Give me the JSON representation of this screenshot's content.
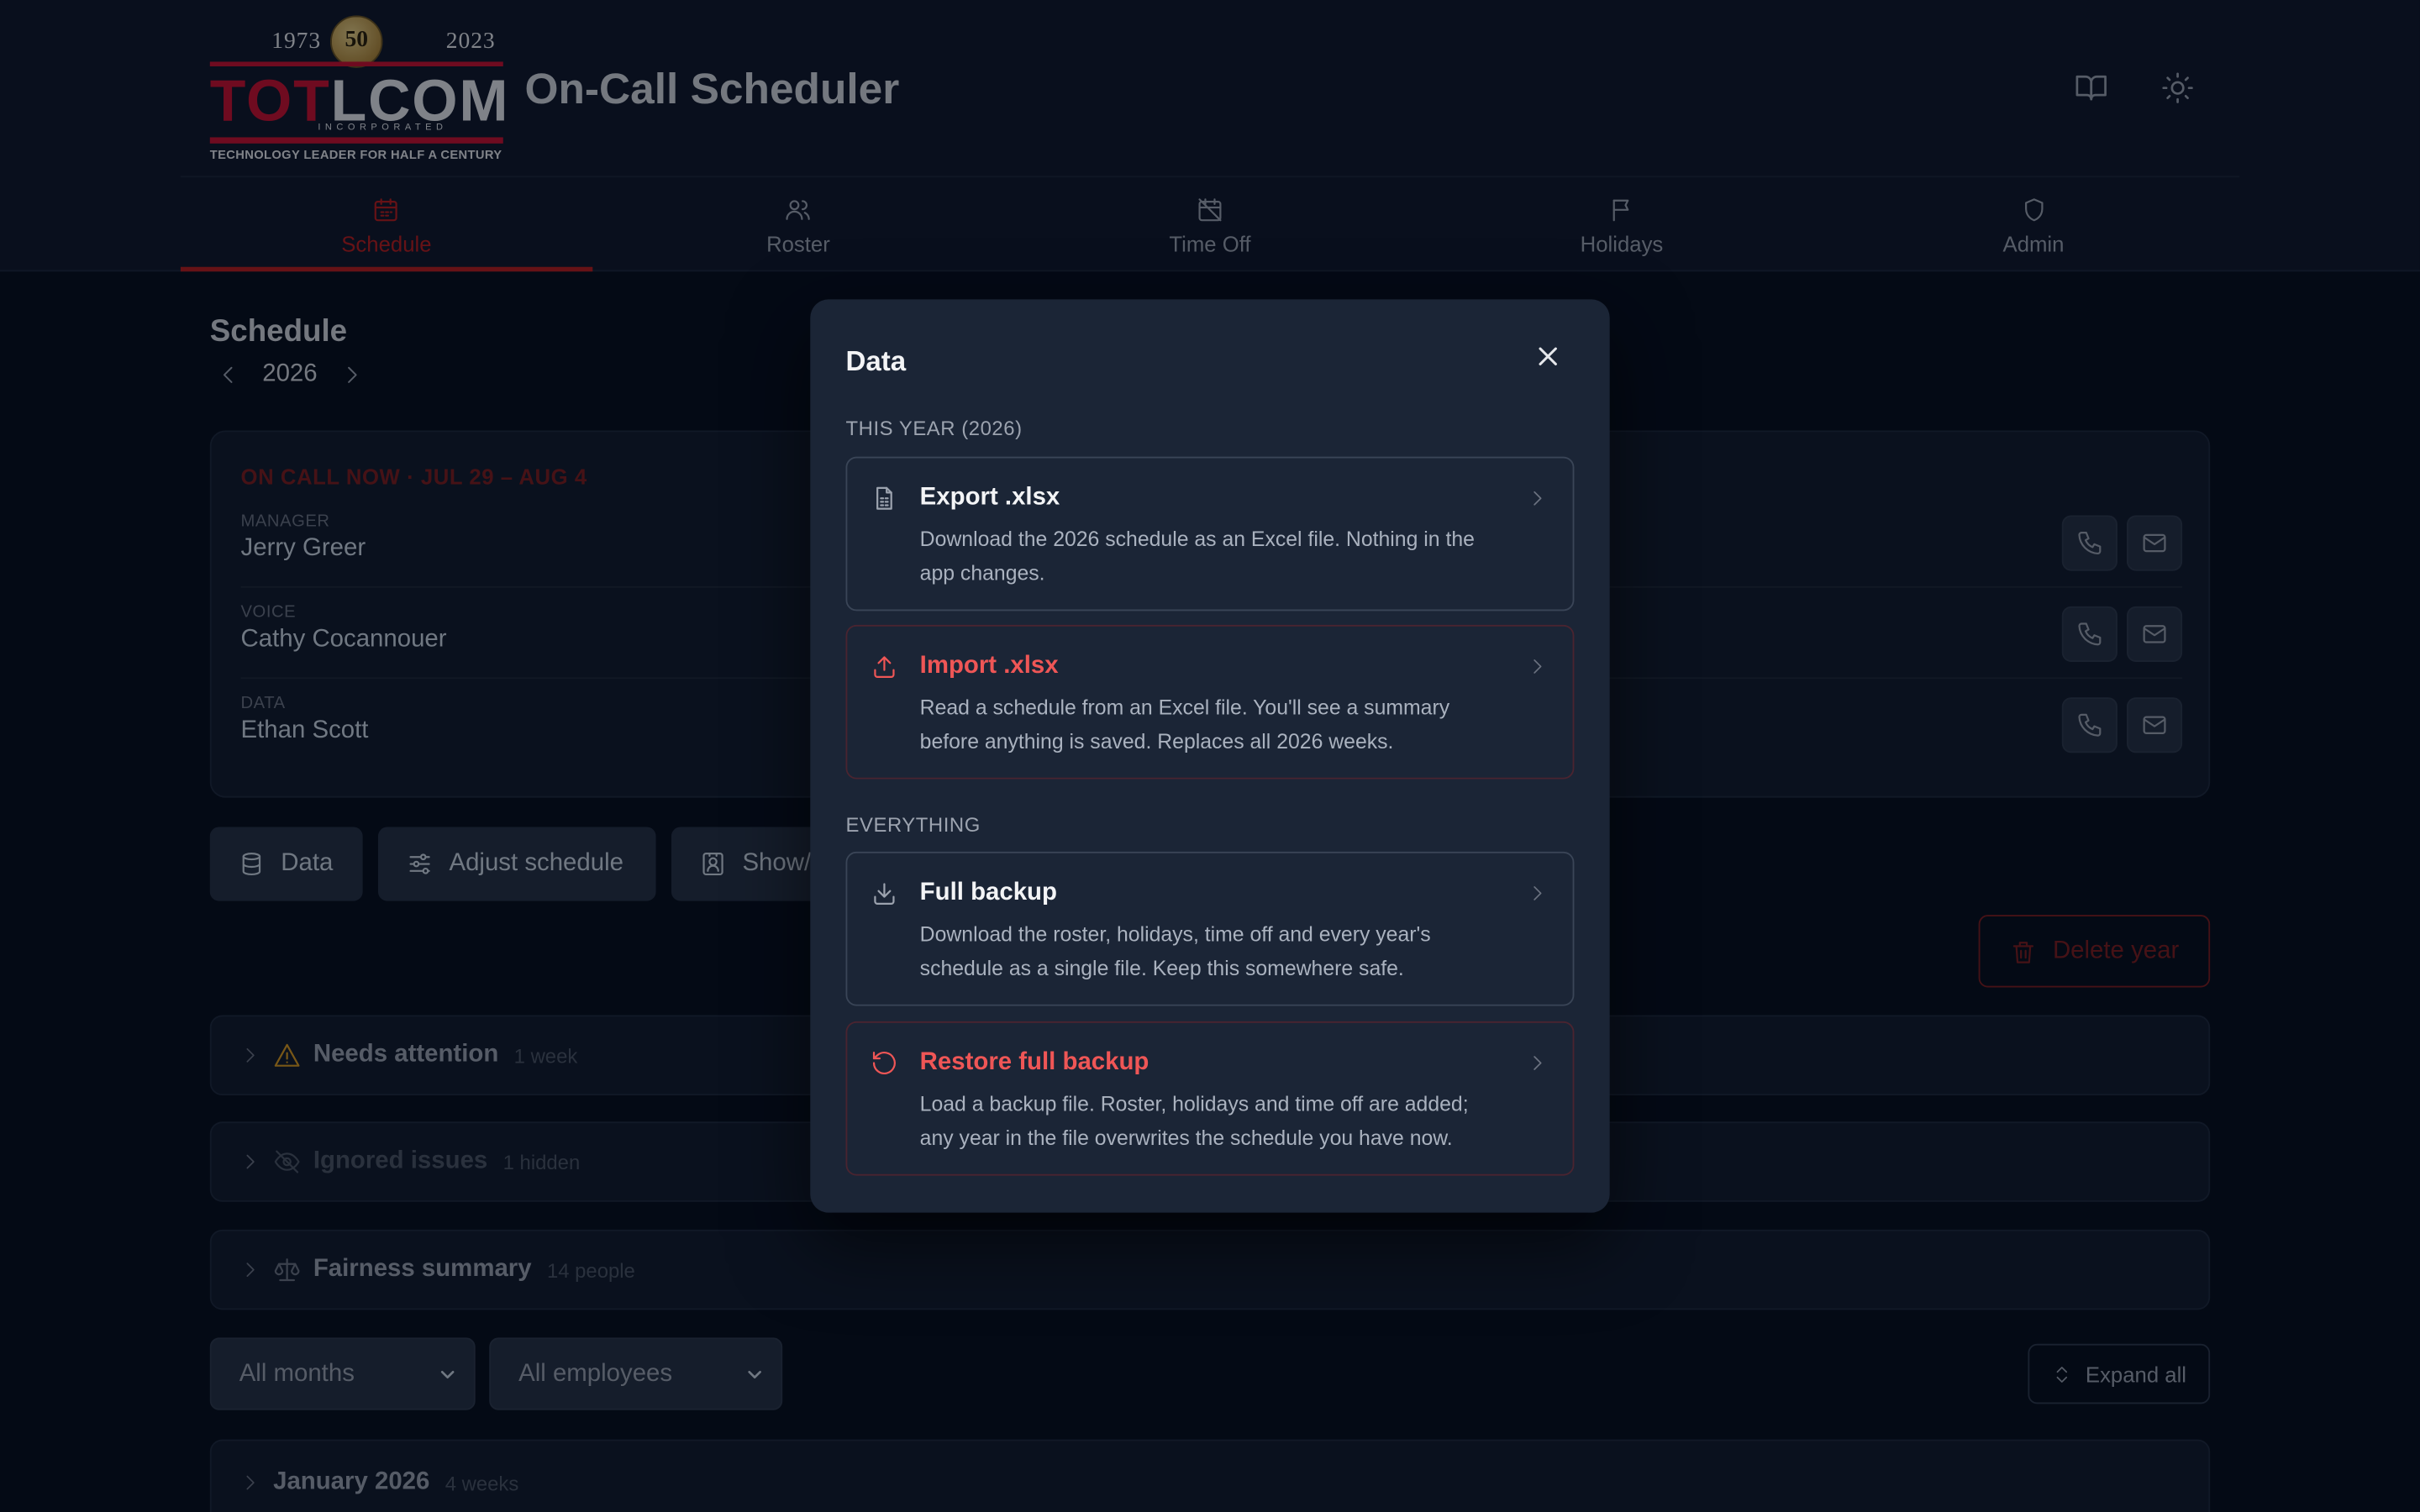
{
  "app": {
    "title": "On-Call Scheduler",
    "logo": {
      "year_start": "1973",
      "medal": "50",
      "year_end": "2023",
      "word_a": "TOT",
      "word_b": "LCOM",
      "incorporated": "INCORPORATED",
      "tagline": "TECHNOLOGY LEADER FOR HALF A CENTURY"
    }
  },
  "nav": {
    "tabs": [
      {
        "label": "Schedule",
        "icon": "calendar-icon",
        "active": true
      },
      {
        "label": "Roster",
        "icon": "users-icon"
      },
      {
        "label": "Time Off",
        "icon": "calendar-off-icon"
      },
      {
        "label": "Holidays",
        "icon": "flag-icon"
      },
      {
        "label": "Admin",
        "icon": "shield-icon"
      }
    ]
  },
  "page": {
    "title": "Schedule",
    "year": "2026"
  },
  "oncall": {
    "heading": "ON CALL NOW · JUL 29 – AUG 4",
    "people": [
      {
        "role": "MANAGER",
        "name": "Jerry Greer"
      },
      {
        "role": "VOICE",
        "name": "Cathy Cocannouer"
      },
      {
        "role": "DATA",
        "name": "Ethan Scott"
      }
    ]
  },
  "toolbar": {
    "data": "Data",
    "adjust": "Adjust schedule",
    "show": "Show/",
    "delete_year": "Delete year"
  },
  "sections": {
    "needs_attention": {
      "title": "Needs attention",
      "count": "1 week"
    },
    "ignored": {
      "title": "Ignored issues",
      "count": "1 hidden"
    },
    "fairness": {
      "title": "Fairness summary",
      "count": "14 people"
    }
  },
  "filters": {
    "months": "All months",
    "employees": "All employees",
    "expand": "Expand all"
  },
  "month": {
    "title": "January 2026",
    "count": "4 weeks"
  },
  "modal": {
    "title": "Data",
    "section_year": "THIS YEAR (2026)",
    "section_all": "EVERYTHING",
    "options": [
      {
        "title": "Export .xlsx",
        "desc": "Download the 2026 schedule as an Excel file. Nothing in the app changes."
      },
      {
        "title": "Import .xlsx",
        "desc": "Read a schedule from an Excel file. You'll see a summary before anything is saved. Replaces all 2026 weeks."
      },
      {
        "title": "Full backup",
        "desc": "Download the roster, holidays, time off and every year's schedule as a single file. Keep this somewhere safe."
      },
      {
        "title": "Restore full backup",
        "desc": "Load a backup file. Roster, holidays and time off are added; any year in the file overwrites the schedule you have now."
      }
    ]
  },
  "colors": {
    "accent": "#b91c1c",
    "danger": "#ef5656",
    "background": "#070d1b"
  }
}
